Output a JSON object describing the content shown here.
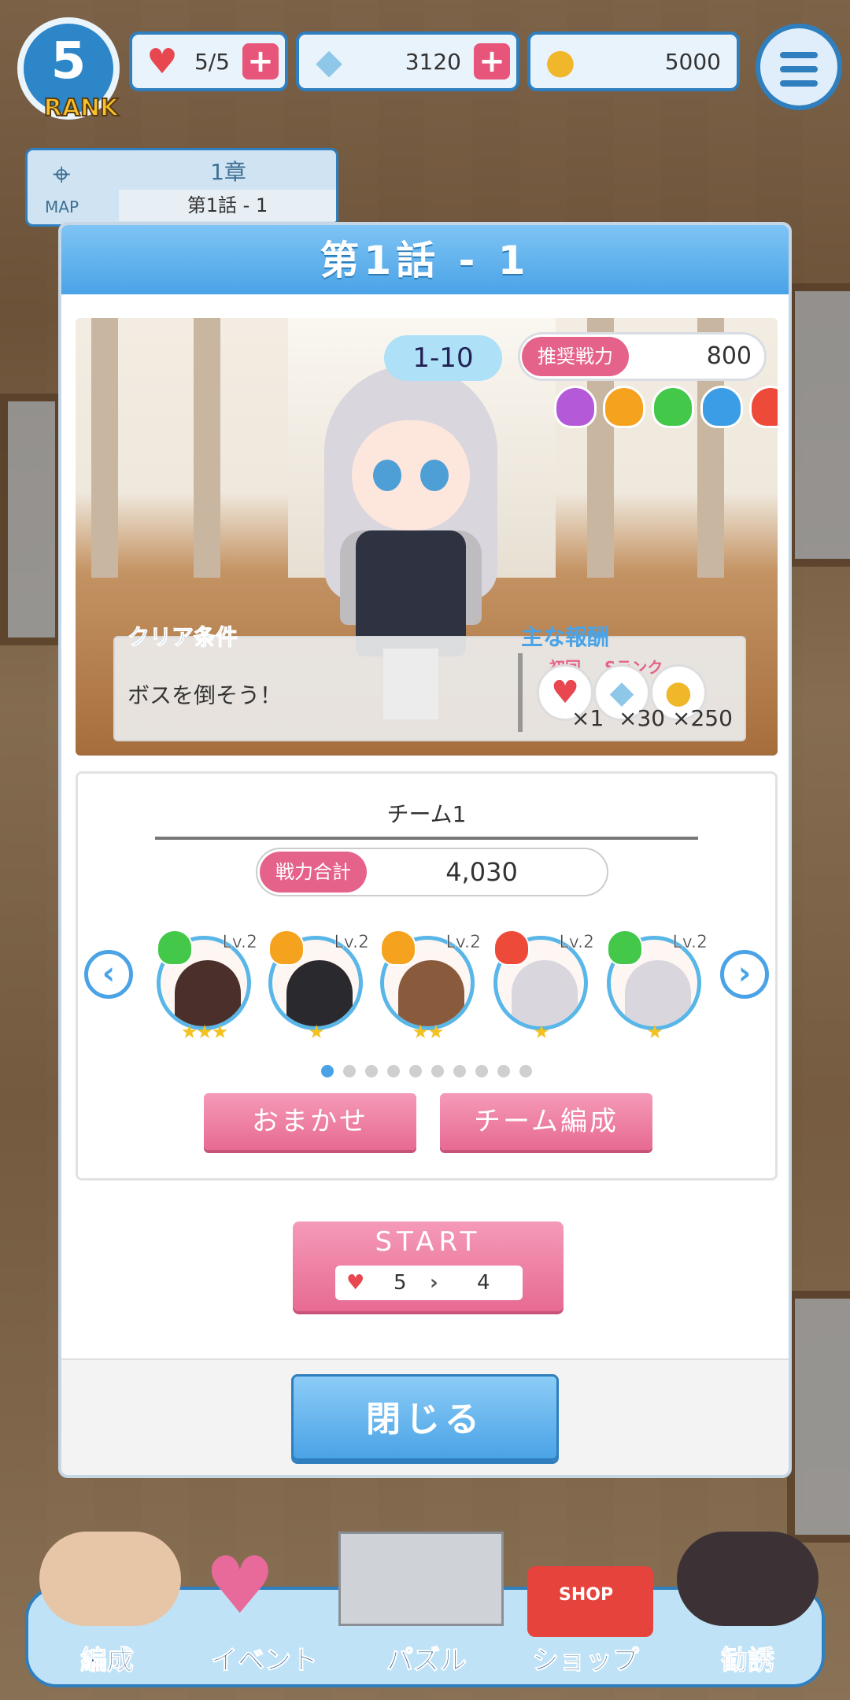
{
  "hud": {
    "rank_value": "5",
    "rank_label": "RANK",
    "stamina": "5/5",
    "gems": "3120",
    "coins": "5000"
  },
  "map": {
    "label": "MAP",
    "chapter": "1章",
    "episode": "第1話 - 1"
  },
  "dialog": {
    "title": "第1話 - 1",
    "stage": "1-10",
    "power_tag": "推奨戦力",
    "power_value": "800",
    "attributes": [
      "#b45ad9",
      "#f5a21f",
      "#43c84a",
      "#3a9de6",
      "#ee4a3a"
    ],
    "clear_label": "クリア条件",
    "clear_text": "ボスを倒そう！",
    "reward_label": "主な報酬",
    "rewards": [
      {
        "tag": "初回",
        "icon": "heart-icon",
        "qty": "×1"
      },
      {
        "tag": "Sランク",
        "icon": "gem-icon",
        "qty": "×30"
      },
      {
        "tag": "",
        "icon": "coin-icon",
        "qty": "×250"
      }
    ],
    "team": {
      "name": "チーム1",
      "total_tag": "戦力合計",
      "total_value": "4,030",
      "members": [
        {
          "level": "Lv.2",
          "element": "#43c84a",
          "hair": "#4a2f2a",
          "stars": "★★★"
        },
        {
          "level": "Lv.2",
          "element": "#f5a21f",
          "hair": "#2a2a2e",
          "stars": "★"
        },
        {
          "level": "Lv.2",
          "element": "#f5a21f",
          "hair": "#8a5a3c",
          "stars": "★★"
        },
        {
          "level": "Lv.2",
          "element": "#ee4a3a",
          "hair": "#d9d6de",
          "stars": "★"
        },
        {
          "level": "Lv.2",
          "element": "#43c84a",
          "hair": "#d9d6de",
          "stars": "★"
        }
      ],
      "page_count": 10,
      "page_current": 1,
      "auto_label": "おまかせ",
      "edit_label": "チーム編成"
    },
    "start": {
      "label": "START",
      "stamina_from": "5",
      "stamina_to": "4"
    },
    "close_label": "閉じる"
  },
  "nav": {
    "items": [
      "編成",
      "イベント",
      "パズル",
      "ショップ",
      "勧誘"
    ],
    "shop_sign": "SHOP"
  }
}
